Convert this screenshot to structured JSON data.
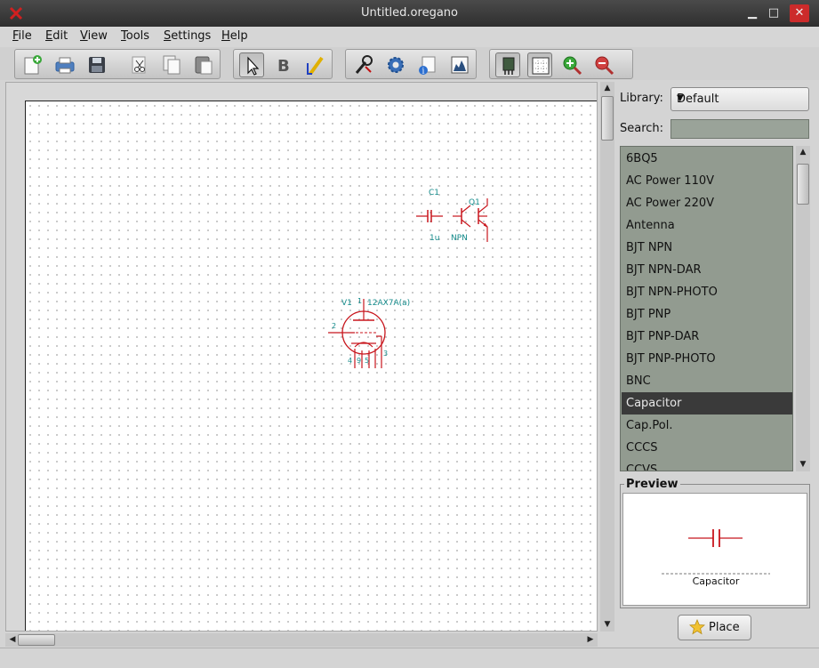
{
  "window": {
    "title": "Untitled.oregano",
    "minimize": "▁",
    "maximize": "□",
    "close": "✕"
  },
  "menu": [
    {
      "label": "File",
      "mnemonic": "F"
    },
    {
      "label": "Edit",
      "mnemonic": "E"
    },
    {
      "label": "View",
      "mnemonic": "V"
    },
    {
      "label": "Tools",
      "mnemonic": "T"
    },
    {
      "label": "Settings",
      "mnemonic": "S"
    },
    {
      "label": "Help",
      "mnemonic": "H"
    }
  ],
  "toolbar": {
    "groups": [
      [
        "new-file-icon",
        "print-icon",
        "save-icon",
        "cut-icon",
        "copy-icon",
        "paste-icon"
      ],
      [
        "pointer-tool-icon",
        "bold-text-tool-icon",
        "wire-tool-icon"
      ],
      [
        "probe-icon",
        "simulation-settings-icon",
        "netlist-info-icon",
        "plot-icon"
      ],
      [
        "part-browser-icon",
        "grid-icon",
        "zoom-in-icon",
        "zoom-out-icon"
      ]
    ],
    "pressed": [
      "pointer-tool-icon",
      "part-browser-icon",
      "grid-icon"
    ]
  },
  "schematic": {
    "capacitor": {
      "ref": "C1",
      "value": "1u"
    },
    "transistor": {
      "ref": "Q1",
      "value": "NPN"
    },
    "tube": {
      "ref": "V1",
      "value": "12AX7A(a)",
      "pins": [
        "1",
        "2",
        "3",
        "4",
        "9",
        "5"
      ]
    }
  },
  "library": {
    "label": "Library:",
    "selected": "Default",
    "search_label": "Search:",
    "search_value": ""
  },
  "parts": [
    "6BQ5",
    "AC Power 110V",
    "AC Power 220V",
    "Antenna",
    "BJT NPN",
    "BJT NPN-DAR",
    "BJT NPN-PHOTO",
    "BJT PNP",
    "BJT PNP-DAR",
    "BJT PNP-PHOTO",
    "BNC",
    "Capacitor",
    "Cap.Pol.",
    "CCCS",
    "CCVS"
  ],
  "selected_part": "Capacitor",
  "preview": {
    "title": "Preview",
    "caption": "Capacitor"
  },
  "place_button": {
    "label": "Place"
  },
  "colors": {
    "schematic_red": "#c8161d",
    "schematic_teal": "#138a8a",
    "selection": "#3a3a3a",
    "list_bg": "#929b90"
  }
}
